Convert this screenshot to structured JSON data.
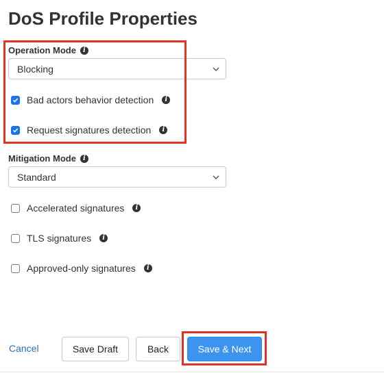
{
  "page": {
    "title": "DoS Profile Properties"
  },
  "operation_mode": {
    "label": "Operation Mode",
    "selected": "Blocking",
    "checkboxes": [
      {
        "label": "Bad actors behavior detection",
        "checked": true
      },
      {
        "label": "Request signatures detection",
        "checked": true
      }
    ]
  },
  "mitigation_mode": {
    "label": "Mitigation Mode",
    "selected": "Standard",
    "checkboxes": [
      {
        "label": "Accelerated signatures",
        "checked": false
      },
      {
        "label": "TLS signatures",
        "checked": false
      },
      {
        "label": "Approved-only signatures",
        "checked": false
      }
    ]
  },
  "footer": {
    "cancel": "Cancel",
    "save_draft": "Save Draft",
    "back": "Back",
    "save_next": "Save & Next"
  },
  "colors": {
    "highlight": "#e53222",
    "primary": "#3b95f0",
    "checkbox_checked": "#1a73e8",
    "link": "#2b6cb8"
  }
}
